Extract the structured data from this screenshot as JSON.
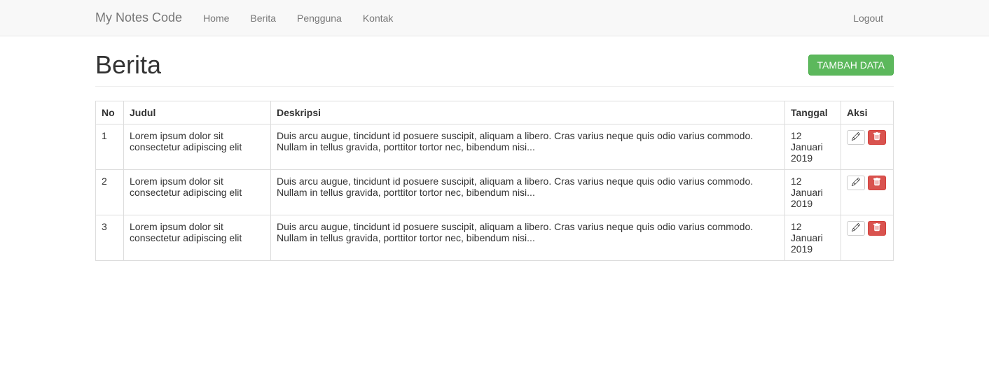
{
  "navbar": {
    "brand": "My Notes Code",
    "items": [
      {
        "label": "Home"
      },
      {
        "label": "Berita"
      },
      {
        "label": "Pengguna"
      },
      {
        "label": "Kontak"
      }
    ],
    "logout": "Logout"
  },
  "page": {
    "title": "Berita",
    "add_button": "TAMBAH DATA"
  },
  "table": {
    "headers": {
      "no": "No",
      "judul": "Judul",
      "deskripsi": "Deskripsi",
      "tanggal": "Tanggal",
      "aksi": "Aksi"
    },
    "rows": [
      {
        "no": "1",
        "judul": "Lorem ipsum dolor sit consectetur adipiscing elit",
        "deskripsi": "Duis arcu augue, tincidunt id posuere suscipit, aliquam a libero. Cras varius neque quis odio varius commodo. Nullam in tellus gravida, porttitor tortor nec, bibendum nisi...",
        "tanggal": "12 Januari 2019"
      },
      {
        "no": "2",
        "judul": "Lorem ipsum dolor sit consectetur adipiscing elit",
        "deskripsi": "Duis arcu augue, tincidunt id posuere suscipit, aliquam a libero. Cras varius neque quis odio varius commodo. Nullam in tellus gravida, porttitor tortor nec, bibendum nisi...",
        "tanggal": "12 Januari 2019"
      },
      {
        "no": "3",
        "judul": "Lorem ipsum dolor sit consectetur adipiscing elit",
        "deskripsi": "Duis arcu augue, tincidunt id posuere suscipit, aliquam a libero. Cras varius neque quis odio varius commodo. Nullam in tellus gravida, porttitor tortor nec, bibendum nisi...",
        "tanggal": "12 Januari 2019"
      }
    ]
  }
}
